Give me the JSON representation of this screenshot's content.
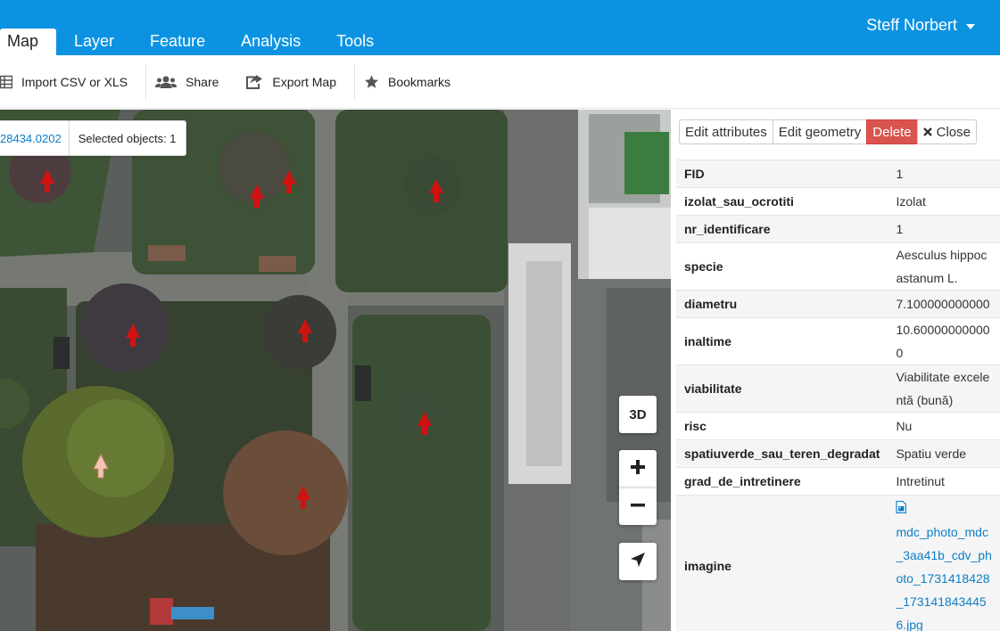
{
  "header": {
    "user_name": "Steff Norbert",
    "tabs": [
      {
        "label": "Map",
        "active": true
      },
      {
        "label": "Layer"
      },
      {
        "label": "Feature"
      },
      {
        "label": "Analysis"
      },
      {
        "label": "Tools"
      }
    ],
    "accent": "#0b93e2"
  },
  "toolbar": {
    "import": {
      "label": "Import CSV or XLS",
      "icon": "table-grid-icon"
    },
    "share": {
      "label": "Share",
      "icon": "users-icon"
    },
    "export": {
      "label": "Export Map",
      "icon": "share-square-icon"
    },
    "bookmarks": {
      "label": "Bookmarks",
      "icon": "star-icon"
    }
  },
  "map": {
    "coordinate": "28434.0202",
    "selected_label": "Selected objects: 1",
    "btn_3d": "3D",
    "zoom_in": "+",
    "zoom_out": "−"
  },
  "panel": {
    "actions": {
      "edit_attributes": "Edit attributes",
      "edit_geometry": "Edit geometry",
      "delete": "Delete",
      "close": "Close"
    },
    "attributes": [
      {
        "key": "FID",
        "value": "1"
      },
      {
        "key": "izolat_sau_ocrotiti",
        "value": "Izolat"
      },
      {
        "key": "nr_identificare",
        "value": "1"
      },
      {
        "key": "specie",
        "value": "Aesculus hippocastanum L."
      },
      {
        "key": "diametru",
        "value": "7.100000000000"
      },
      {
        "key": "inaltime",
        "value": "10.600000000000"
      },
      {
        "key": "viabilitate",
        "value": "Viabilitate excelentă (bună)"
      },
      {
        "key": "risc",
        "value": "Nu"
      },
      {
        "key": "spatiuverde_sau_teren_degradat",
        "value": "Spatiu verde"
      },
      {
        "key": "grad_de_intretinere",
        "value": "Intretinut"
      },
      {
        "key": "imagine",
        "value": "mdc_photo_mdc_3aa41b_cdv_photo_1731418428_1731418434456.jpg",
        "icon": "image-file-icon"
      }
    ],
    "delete_color": "#d9534f",
    "link_color": "#0b7fc7"
  }
}
